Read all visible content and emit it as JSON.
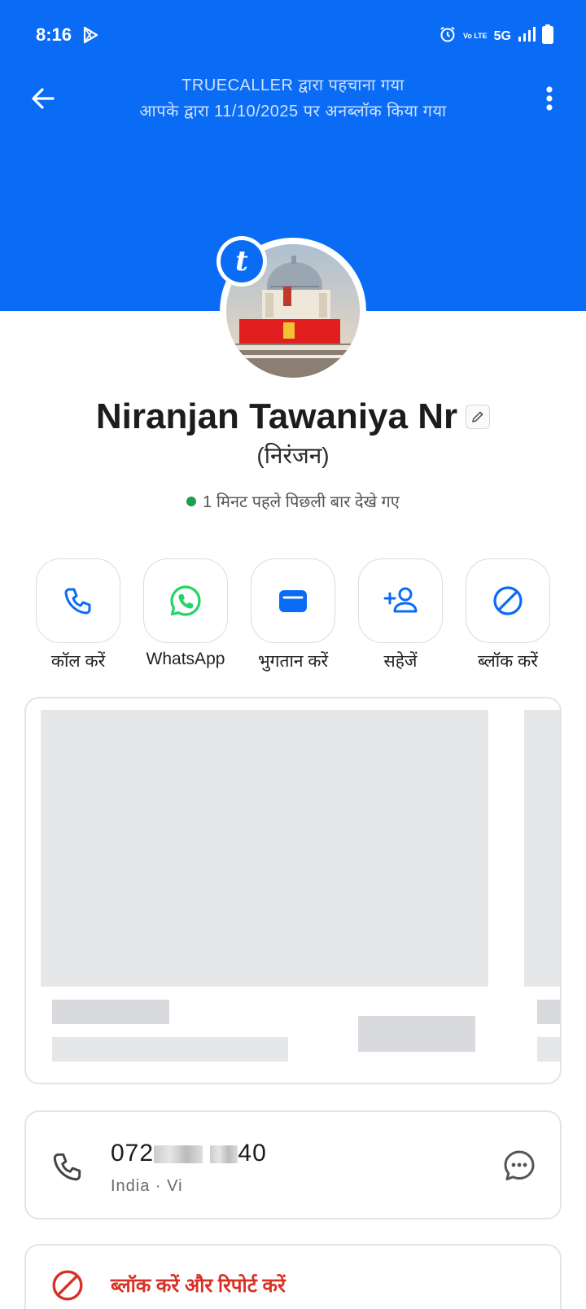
{
  "status_bar": {
    "time": "8:16",
    "network": "5G",
    "volte": "Vo LTE",
    "icons": [
      "play-store-icon",
      "alarm-icon",
      "signal-icon",
      "battery-icon"
    ]
  },
  "header": {
    "line1": "TRUECALLER द्वारा पहचाना गया",
    "line2": "आपके द्वारा 11/10/2025 पर अनब्लॉक किया गया",
    "color": "#0a6cf5"
  },
  "profile": {
    "badge_letter": "t",
    "name": "Niranjan Tawaniya Nr",
    "alt_name": "(निरंजन)",
    "last_seen": "1 मिनट पहले पिछली बार देखे गए"
  },
  "actions": [
    {
      "label": "कॉल करें",
      "icon": "phone-icon"
    },
    {
      "label": "WhatsApp",
      "icon": "whatsapp-icon"
    },
    {
      "label": "भुगतान करें",
      "icon": "wallet-icon"
    },
    {
      "label": "सहेजें",
      "icon": "add-person-icon"
    },
    {
      "label": "ब्लॉक करें",
      "icon": "block-icon"
    }
  ],
  "phone": {
    "prefix": "072",
    "suffix": "40",
    "sub": "India · Vi"
  },
  "block_report": {
    "label": "ब्लॉक करें और रिपोर्ट करें",
    "color": "#d93025"
  }
}
